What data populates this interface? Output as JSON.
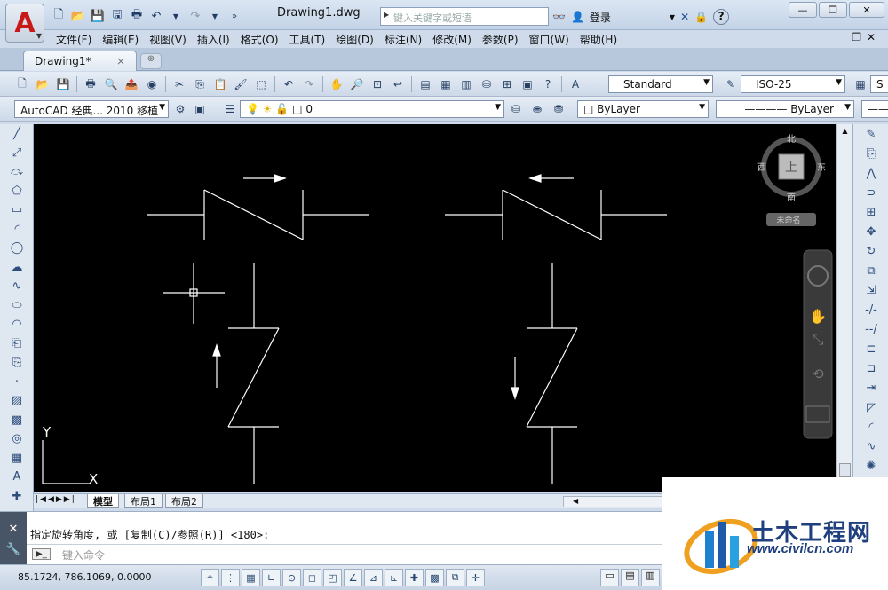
{
  "titlebar": {
    "doc_title": "Drawing1.dwg",
    "search_placeholder": "键入关键字或短语",
    "login_label": "登录",
    "help_label": "?"
  },
  "menu": [
    "文件(F)",
    "编辑(E)",
    "视图(V)",
    "插入(I)",
    "格式(O)",
    "工具(T)",
    "绘图(D)",
    "标注(N)",
    "修改(M)",
    "参数(P)",
    "窗口(W)",
    "帮助(H)"
  ],
  "tabs": {
    "active": "Drawing1*",
    "close": "×"
  },
  "toolbar1": {
    "text_style": "Standard",
    "dim_style": "ISO-25",
    "right_combo": "S"
  },
  "toolbar2": {
    "workspace": "AutoCAD 经典... 2010 移植",
    "layer": "0",
    "color": "ByLayer",
    "linetype": "ByLayer"
  },
  "viewcube": {
    "north": "北",
    "south": "南",
    "east": "东",
    "west": "西",
    "face": "上",
    "ucs": "未命名"
  },
  "layout_tabs": [
    "模型",
    "布局1",
    "布局2"
  ],
  "command": {
    "history": "指定旋转角度, 或 [复制(C)/参照(R)] <180>:",
    "placeholder": "键入命令"
  },
  "status": {
    "coords": "85.1724,  786.1069, 0.0000"
  },
  "ucs": {
    "x": "X",
    "y": "Y"
  },
  "watermark": {
    "title": "土木工程网",
    "url": "www.civilcn.com"
  },
  "colors": {
    "canvas": "#000000",
    "lines": "#ffffff",
    "brand": "#1f3f7e"
  }
}
